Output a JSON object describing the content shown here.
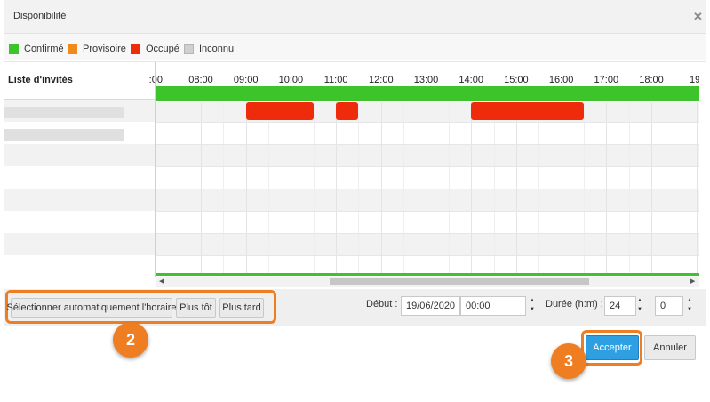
{
  "dialog": {
    "title": "Disponibilité",
    "close_icon": "close-icon",
    "close_glyph": "✕"
  },
  "legend": [
    {
      "label": "Confirmé",
      "color": "#3cc42a"
    },
    {
      "label": "Provisoire",
      "color": "#f08a1a"
    },
    {
      "label": "Occupé",
      "color": "#ee2b0b"
    },
    {
      "label": "Inconnu",
      "color": "#d0d0d0"
    }
  ],
  "grid": {
    "list_title": "Liste d'invités",
    "times": [
      ":00",
      "08:00",
      "09:00",
      "10:00",
      "11:00",
      "12:00",
      "13:00",
      "14:00",
      "15:00",
      "16:00",
      "17:00",
      "18:00",
      "19:"
    ],
    "confirmed_color": "#3cc42a",
    "busy_blocks": [
      {
        "start": "09:00",
        "end": "10:30"
      },
      {
        "start": "11:00",
        "end": "11:30"
      },
      {
        "start": "14:00",
        "end": "16:30"
      }
    ]
  },
  "footer": {
    "auto_select_label": "Sélectionner automatiquement l'horaire",
    "earlier_label": "Plus tôt",
    "later_label": "Plus tard",
    "start_label": "Début :",
    "start_date": "19/06/2020",
    "start_time": "00:00",
    "duration_label": "Durée (h:m) :",
    "duration_hours": "24",
    "duration_sep": ":",
    "duration_minutes": "0"
  },
  "actions": {
    "accept_label": "Accepter",
    "cancel_label": "Annuler"
  },
  "badges": {
    "step2": "2",
    "step3": "3"
  },
  "highlight_color": "#ef7d22"
}
